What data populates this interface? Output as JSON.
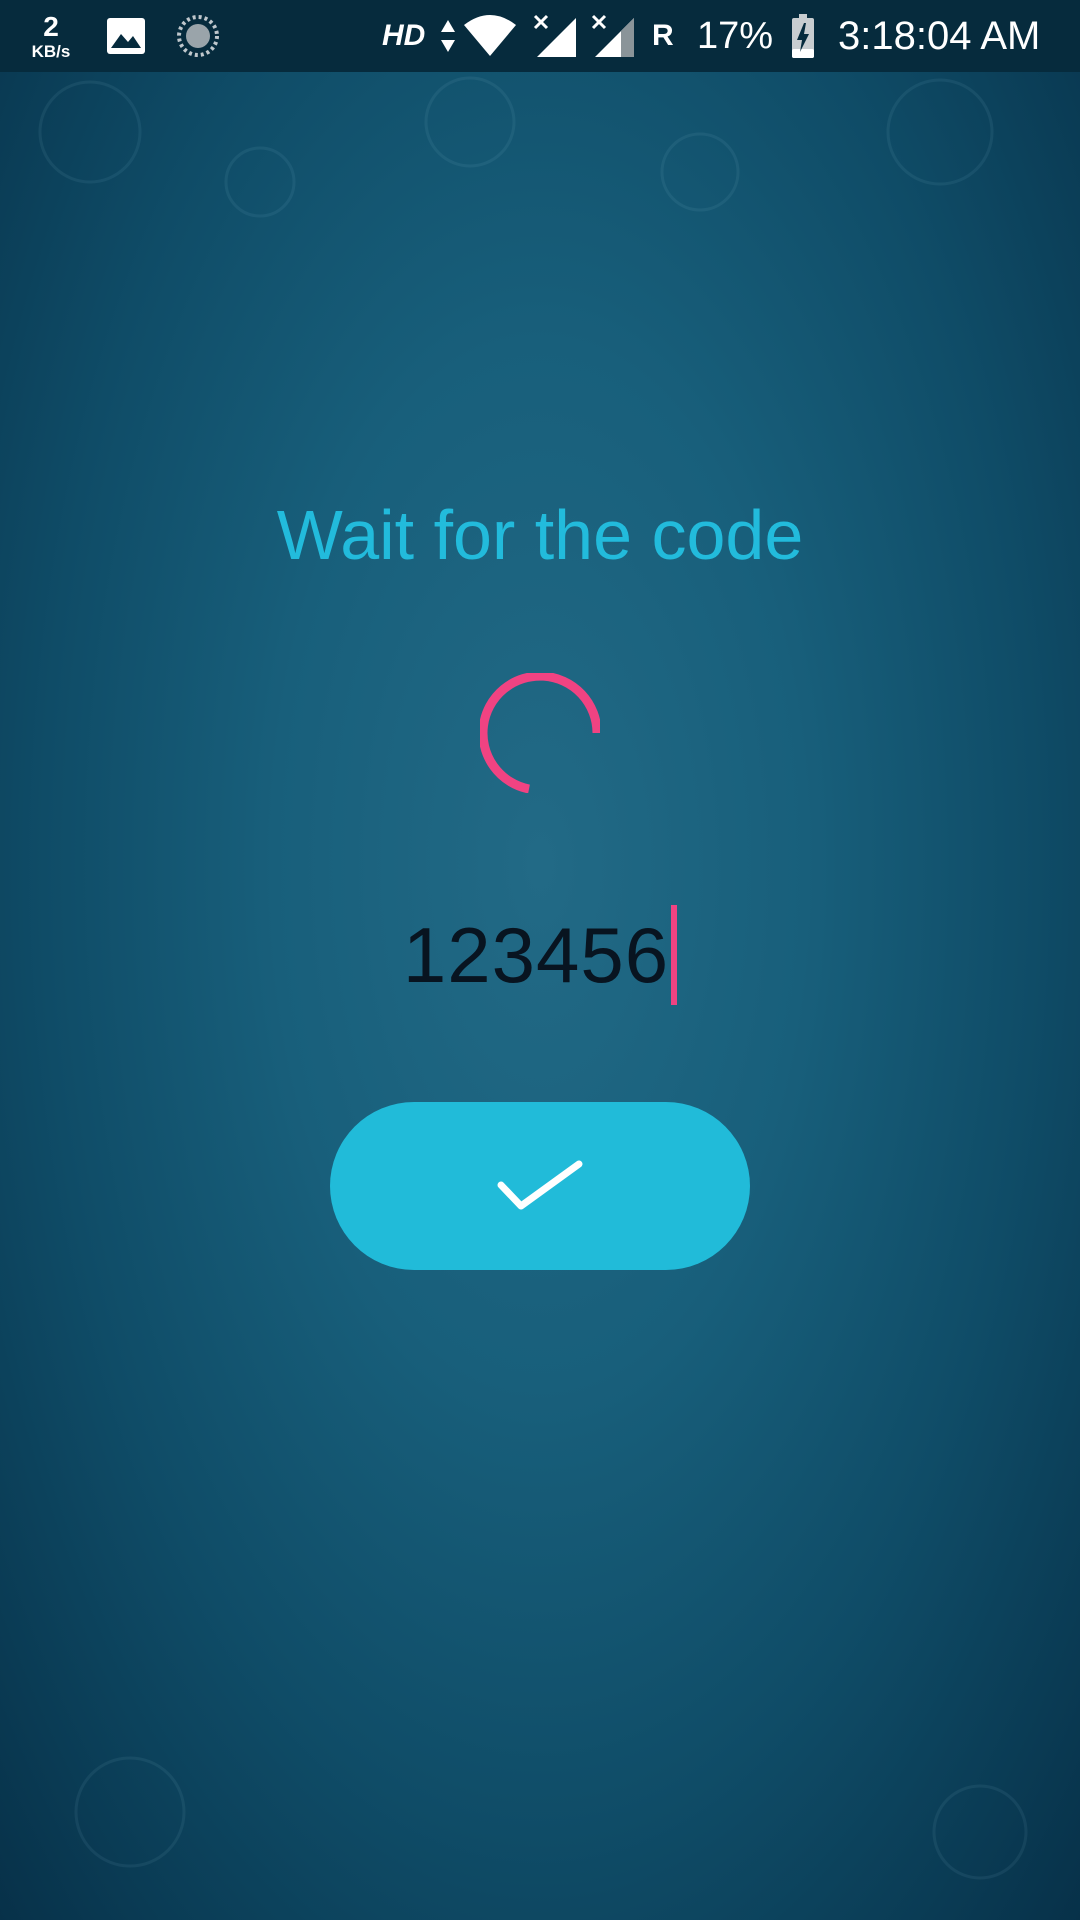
{
  "status_bar": {
    "net_speed_value": "2",
    "net_speed_unit": "KB/s",
    "network_type": "HD",
    "roaming": "R",
    "battery_percent": "17%",
    "time": "3:18:04 AM",
    "icons": [
      "image-notification-icon",
      "sync-icon",
      "data-arrows-icon",
      "wifi-icon",
      "signal-icon",
      "signal-icon",
      "battery-charging-icon"
    ]
  },
  "verification": {
    "title": "Wait for the code",
    "code_value": "123456",
    "submit_icon": "checkmark-icon"
  },
  "colors": {
    "accent": "#22bbdc",
    "button": "#21bbd9",
    "spinner": "#f04382",
    "caret": "#f04382",
    "background": "#185f7b",
    "status_bar": "#062b3d"
  }
}
